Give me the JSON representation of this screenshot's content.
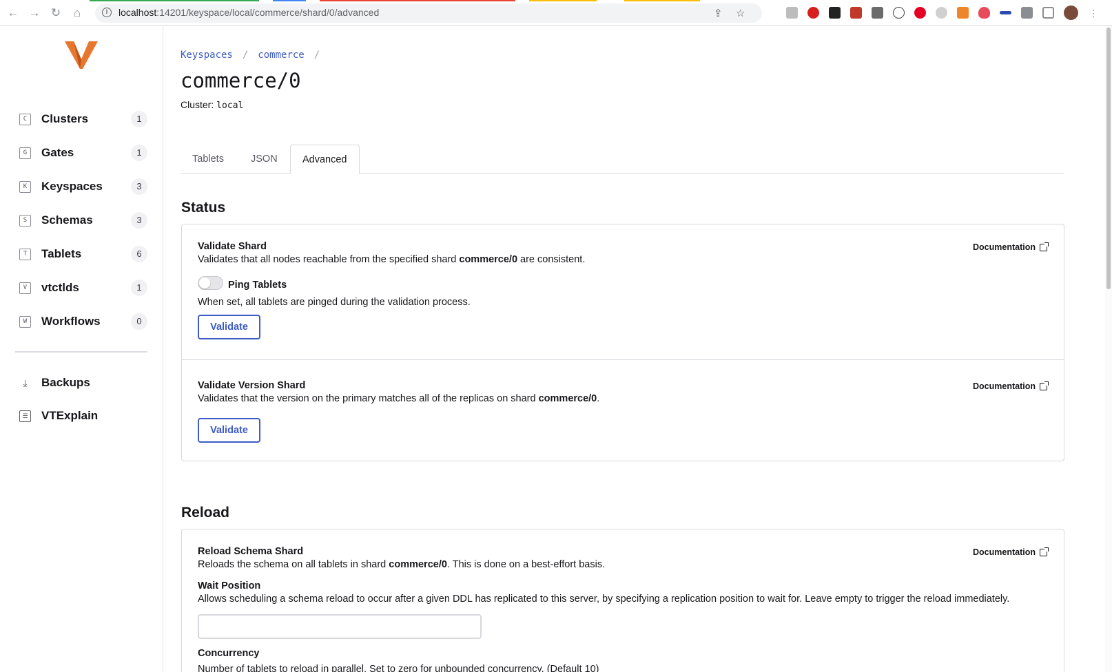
{
  "browser": {
    "url_host": "localhost",
    "url_path": ":14201/keyspace/local/commerce/shard/0/advanced"
  },
  "sidebar": {
    "items": [
      {
        "letter": "C",
        "label": "Clusters",
        "count": "1"
      },
      {
        "letter": "G",
        "label": "Gates",
        "count": "1"
      },
      {
        "letter": "K",
        "label": "Keyspaces",
        "count": "3"
      },
      {
        "letter": "S",
        "label": "Schemas",
        "count": "3"
      },
      {
        "letter": "T",
        "label": "Tablets",
        "count": "6"
      },
      {
        "letter": "V",
        "label": "vtctlds",
        "count": "1"
      },
      {
        "letter": "W",
        "label": "Workflows",
        "count": "0"
      }
    ],
    "secondary": [
      {
        "label": "Backups"
      },
      {
        "label": "VTExplain"
      }
    ],
    "accent": "#e8772e"
  },
  "breadcrumb": {
    "root": "Keyspaces",
    "keyspace": "commerce",
    "sep": "/"
  },
  "page": {
    "title": "commerce/0",
    "cluster_label": "Cluster:",
    "cluster_value": "local"
  },
  "tabs": [
    {
      "label": "Tablets"
    },
    {
      "label": "JSON"
    },
    {
      "label": "Advanced"
    }
  ],
  "status": {
    "title": "Status",
    "validate_shard": {
      "title": "Validate Shard",
      "desc_pre": "Validates that all nodes reachable from the specified shard ",
      "desc_bold": "commerce/0",
      "desc_post": " are consistent.",
      "doc": "Documentation",
      "toggle_label": "Ping Tablets",
      "toggle_on": false,
      "toggle_desc": "When set, all tablets are pinged during the validation process.",
      "button": "Validate"
    },
    "validate_version": {
      "title": "Validate Version Shard",
      "desc_pre": "Validates that the version on the primary matches all of the replicas on shard ",
      "desc_bold": "commerce/0",
      "desc_post": ".",
      "doc": "Documentation",
      "button": "Validate"
    }
  },
  "reload": {
    "title": "Reload",
    "reload_schema": {
      "title": "Reload Schema Shard",
      "desc_pre": "Reloads the schema on all tablets in shard ",
      "desc_bold": "commerce/0",
      "desc_post": ". This is done on a best-effort basis.",
      "doc": "Documentation",
      "wait_label": "Wait Position",
      "wait_desc": "Allows scheduling a schema reload to occur after a given DDL has replicated to this server, by specifying a replication position to wait for. Leave empty to trigger the reload immediately.",
      "wait_value": "",
      "concurrency_label": "Concurrency",
      "concurrency_desc": "Number of tablets to reload in parallel. Set to zero for unbounded concurrency. (Default 10)"
    }
  },
  "colors": {
    "link": "#3d5bc4",
    "border": "#d8d8de"
  }
}
